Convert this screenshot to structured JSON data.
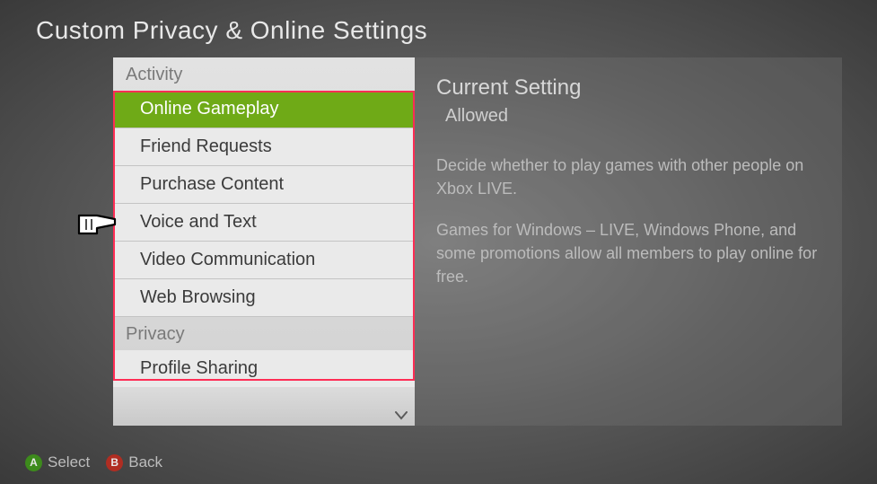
{
  "title": "Custom Privacy & Online Settings",
  "sections": {
    "activity": {
      "label": "Activity",
      "items": [
        {
          "label": "Online Gameplay",
          "selected": true
        },
        {
          "label": "Friend Requests",
          "selected": false
        },
        {
          "label": "Purchase Content",
          "selected": false
        },
        {
          "label": "Voice and Text",
          "selected": false
        },
        {
          "label": "Video Communication",
          "selected": false
        },
        {
          "label": "Web Browsing",
          "selected": false
        }
      ]
    },
    "privacy": {
      "label": "Privacy",
      "items": [
        {
          "label": "Profile Sharing",
          "selected": false
        }
      ]
    }
  },
  "detail": {
    "heading": "Current Setting",
    "value": "Allowed",
    "desc1": "Decide whether to play games with other people on Xbox LIVE.",
    "desc2": "Games for Windows – LIVE, Windows Phone, and some promotions allow all members to play online for free."
  },
  "footer": {
    "a_glyph": "A",
    "a_label": "Select",
    "b_glyph": "B",
    "b_label": "Back"
  }
}
